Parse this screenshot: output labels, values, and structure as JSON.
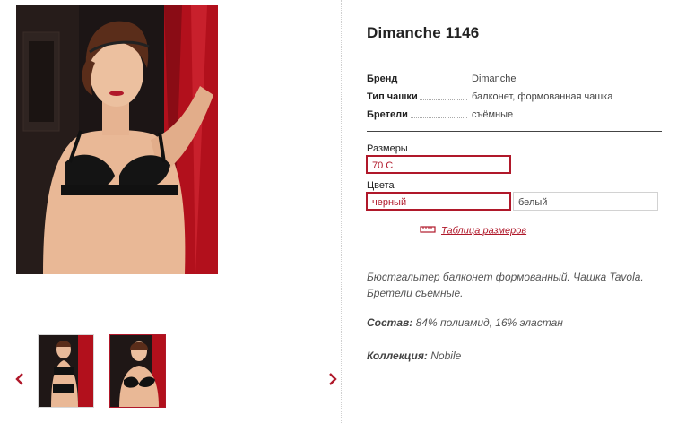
{
  "product": {
    "title": "Dimanche 1146",
    "properties": [
      {
        "key": "Бренд",
        "value": "Dimanche"
      },
      {
        "key": "Тип чашки",
        "value": "балконет, формованная чашка"
      },
      {
        "key": "Бретели",
        "value": "съёмные"
      }
    ],
    "sizes_label": "Размеры",
    "sizes": [
      "70 C"
    ],
    "selected_size": "70 C",
    "colors_label": "Цвета",
    "colors": [
      "черный",
      "белый"
    ],
    "selected_color": "черный",
    "size_table_link": "Таблица размеров",
    "description": "Бюстгальтер балконет формованный. Чашка Tavola. Бретели съемные.",
    "composition_label": "Состав:",
    "composition_value": "84% полиамид, 16% эластан",
    "collection_label": "Коллекция:",
    "collection_value": "Nobile"
  },
  "gallery": {
    "main_image_alt": "product-photo",
    "thumbnail_count": 2,
    "selected_thumbnail": 2
  },
  "colors": {
    "accent": "#b0182a",
    "divider": "#444444"
  },
  "icons": {
    "prev": "chevron-left-icon",
    "next": "chevron-right-icon",
    "size_table": "ruler-icon"
  }
}
